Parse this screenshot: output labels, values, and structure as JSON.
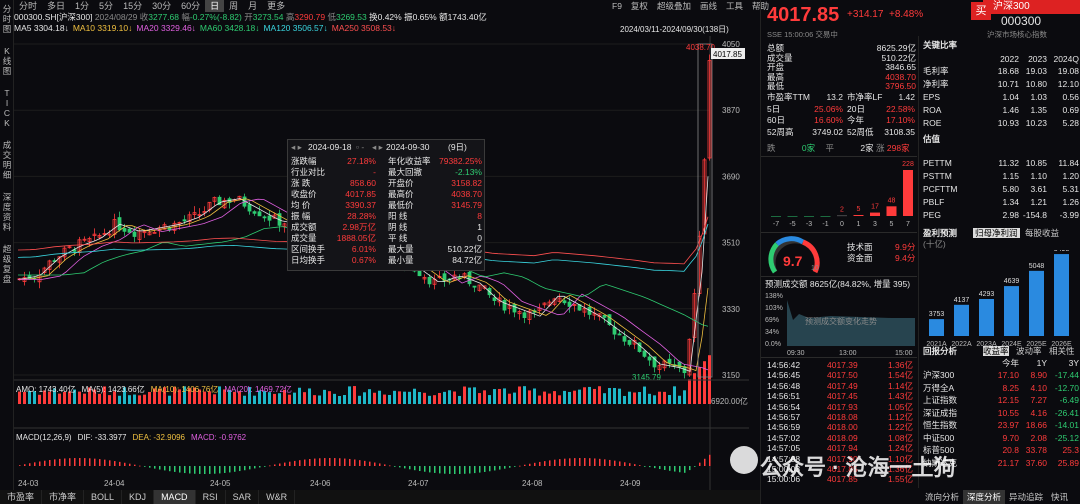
{
  "left_sidebar": [
    "分时图",
    "K线图",
    "TICK",
    "成交明细",
    "深度资料",
    "超级复盘"
  ],
  "top_menu": [
    "分时",
    "多日",
    "1分",
    "5分",
    "15分",
    "30分",
    "60分",
    "日",
    "周",
    "月",
    "更多"
  ],
  "top_menu_active": "日",
  "top_right": [
    "F9",
    "复权",
    "超级叠加",
    "画线",
    "工具",
    "帮助"
  ],
  "quote_line": {
    "code": "000300.SH[沪深300]",
    "date": "2024/08/29",
    "close_label": "收",
    "close": "3277.68",
    "chg_label": "幅",
    "chg": "-0.27%(-8.82)",
    "open_label": "开",
    "open": "3273.54",
    "high_label": "高",
    "high": "3290.79",
    "low_label": "低",
    "low": "3269.53",
    "turnover": "换0.42%",
    "amp": "振0.65%",
    "amount": "额1743.40亿"
  },
  "ma_line": [
    {
      "t": "MA5",
      "v": "3304.18↓",
      "c": "#e6e6e6"
    },
    {
      "t": "MA10",
      "v": "3319.10↓",
      "c": "#f0c040"
    },
    {
      "t": "MA20",
      "v": "3329.46↓",
      "c": "#e060e0"
    },
    {
      "t": "MA60",
      "v": "3428.18↓",
      "c": "#2ecc71"
    },
    {
      "t": "MA120",
      "v": "3506.57↓",
      "c": "#3ad6e0"
    },
    {
      "t": "MA250",
      "v": "3508.53↓",
      "c": "#ff5050"
    }
  ],
  "range_label": "2024/03/11-2024/09/30(138日)",
  "price_axis": [
    "4050",
    "3870",
    "3690",
    "3510",
    "3330",
    "3150"
  ],
  "price_high_label": "4038.70",
  "price_low_label": "3145.79",
  "last_tag": "4017.85",
  "vol_line": {
    "amo": "AMO: 1743.40亿",
    "ma5": "MA(5): 1423.66亿",
    "ma10": "MA(10): 1406.76亿",
    "ma20": "MA(20): 1469.72亿"
  },
  "vol_axis": "6920.00亿",
  "macd_line": {
    "name": "MACD(12,26,9)",
    "dif": "DIF: -33.3977",
    "dea": "DEA: -32.9096",
    "macd": "MACD: -0.9762"
  },
  "date_axis": [
    "24-03",
    "24-04",
    "24-05",
    "24-06",
    "24-07",
    "24-08",
    "24-09"
  ],
  "tooltip": {
    "start": "2024-09-18",
    "end": "2024-09-30",
    "days": "(9日)",
    "rows": [
      [
        "涨跌幅",
        "27.18%",
        "年化收益率",
        "79382.25%"
      ],
      [
        "行业对比",
        "-",
        "最大回撤",
        "-2.13%"
      ],
      [
        "涨 跌",
        "858.60",
        "开盘价",
        "3158.82"
      ],
      [
        "收盘价",
        "4017.85",
        "最高价",
        "4038.70"
      ],
      [
        "均 价",
        "3390.37",
        "最低价",
        "3145.79"
      ],
      [
        "振 幅",
        "28.28%",
        "阳 线",
        "8"
      ],
      [
        "成交额",
        "2.98万亿",
        "阴 线",
        "1"
      ],
      [
        "成交量",
        "1888.05亿",
        "平 线",
        "0"
      ],
      [
        "区间换手",
        "6.01%",
        "最大量",
        "510.22亿"
      ],
      [
        "日均换手",
        "0.67%",
        "最小量",
        "84.72亿"
      ]
    ]
  },
  "bottom_tabs": [
    "市盈率",
    "市净率",
    "BOLL",
    "KDJ",
    "MACD",
    "RSI",
    "SAR",
    "W&R"
  ],
  "bottom_tab_active": "MACD",
  "right": {
    "price": "4017.85",
    "chg": "+314.17",
    "pct": "+8.48%",
    "name": "沪深300",
    "code": "000300",
    "buy": "买",
    "sub1": "SSE  15:00:06  交易中",
    "sub2": "沪深市场核心指数",
    "stats": [
      [
        "总额",
        "8625.29亿"
      ],
      [
        "成交量",
        "510.22亿"
      ],
      [
        "开盘",
        "3846.65"
      ],
      [
        "最高",
        "4038.70"
      ],
      [
        "最低",
        "3796.50"
      ]
    ],
    "stats2": [
      [
        "市盈率TTM",
        "13.2",
        "市净率LF",
        "1.42"
      ],
      [
        "5日",
        "25.06%",
        "20日",
        "22.58%"
      ],
      [
        "60日",
        "16.60%",
        "今年",
        "17.10%"
      ],
      [
        "52周高",
        "3749.02",
        "52周低",
        "3108.35"
      ]
    ],
    "updown": {
      "die_label": "跌",
      "die": "0家",
      "ping_label": "平",
      "ping": "2家",
      "zhang_label": "涨",
      "zhang": "298家"
    },
    "dist_labels": [
      "-7",
      "-5",
      "-3",
      "-1",
      "0",
      "1",
      "3",
      "5",
      "7"
    ],
    "dist_values": [
      0,
      0,
      0,
      0,
      2,
      5,
      17,
      48,
      228
    ],
    "score": "9.7",
    "score_max": "10",
    "tech": "技术面",
    "tech_v": "9.9分",
    "fund": "资金面",
    "fund_v": "9.4分",
    "forecast": "预测成交额 8625亿(84.82%, 增量 395)",
    "forecast_axis": [
      "138%",
      "103%",
      "69%",
      "34%",
      "0.0%"
    ],
    "forecast_note": "预测成交额变化走势",
    "forecast_x": [
      "09:30",
      "13:00",
      "15:00"
    ],
    "ticks": [
      [
        "14:56:42",
        "4017.39",
        "1.36亿"
      ],
      [
        "14:56:45",
        "4017.50",
        "1.54亿"
      ],
      [
        "14:56:48",
        "4017.49",
        "1.14亿"
      ],
      [
        "14:56:51",
        "4017.45",
        "1.43亿"
      ],
      [
        "14:56:54",
        "4017.93",
        "1.05亿"
      ],
      [
        "14:56:57",
        "4018.08",
        "1.12亿"
      ],
      [
        "14:56:59",
        "4018.00",
        "1.22亿"
      ],
      [
        "14:57:02",
        "4018.09",
        "1.08亿"
      ],
      [
        "14:57:05",
        "4017.94",
        "1.24亿"
      ],
      [
        "14:57:08",
        "4017.90",
        "1.10亿"
      ],
      [
        "15:00:03",
        "4017.85",
        "1.36亿"
      ],
      [
        "15:00:06",
        "4017.85",
        "1.55亿"
      ]
    ]
  },
  "fin": {
    "title": "关键比率",
    "years": [
      "2022",
      "2023",
      "2024Q"
    ],
    "rows": [
      [
        "毛利率",
        "18.68",
        "19.03",
        "19.08"
      ],
      [
        "净利率",
        "10.71",
        "10.80",
        "12.10"
      ],
      [
        "EPS",
        "1.04",
        "1.03",
        "0.56"
      ],
      [
        "ROA",
        "1.46",
        "1.35",
        "0.69"
      ],
      [
        "ROE",
        "10.93",
        "10.23",
        "5.28"
      ]
    ],
    "val_title": "估值",
    "val_rows": [
      [
        "PETTM",
        "11.32",
        "10.85",
        "11.84"
      ],
      [
        "PSTTM",
        "1.15",
        "1.10",
        "1.20"
      ],
      [
        "PCFTTM",
        "5.80",
        "3.61",
        "5.31"
      ],
      [
        "PBLF",
        "1.34",
        "1.21",
        "1.26"
      ],
      [
        "PEG",
        "2.98",
        "-154.8",
        "-3.99"
      ]
    ],
    "forecast_title": "盈利预测",
    "forecast_unit": "(十亿)",
    "tabs": [
      "归母净利润",
      "每股收益"
    ],
    "bars": [
      [
        "2021A",
        "3753"
      ],
      [
        "2022A",
        "4137"
      ],
      [
        "2023A",
        "4293"
      ],
      [
        "2024E",
        "4639"
      ],
      [
        "2025E",
        "5048"
      ],
      [
        "2026E",
        "5498"
      ]
    ],
    "ret_title": "回报分析",
    "ret_tabs": [
      "收益率",
      "波动率",
      "相关性"
    ],
    "ret_cols": [
      "今年",
      "1Y",
      "3Y"
    ],
    "ret_rows": [
      [
        "沪深300",
        "17.10",
        "8.90",
        "-17.44"
      ],
      [
        "万得全A",
        "8.25",
        "4.10",
        "-12.70"
      ],
      [
        "上证指数",
        "12.15",
        "7.27",
        "-6.49"
      ],
      [
        "深证成指",
        "10.55",
        "4.16",
        "-26.41"
      ],
      [
        "恒生指数",
        "23.97",
        "18.66",
        "-14.01"
      ],
      [
        "中证500",
        "9.70",
        "2.08",
        "-25.12"
      ],
      [
        "标普500",
        "20.8",
        "33.78",
        "25.3"
      ],
      [
        "纳斯达克",
        "21.17",
        "37.60",
        "25.89"
      ]
    ]
  },
  "bottom_right_tabs": [
    "流向分析",
    "深度分析",
    "异动追踪",
    "快讯"
  ],
  "watermark": "公众号 · 沧海一土狗"
}
